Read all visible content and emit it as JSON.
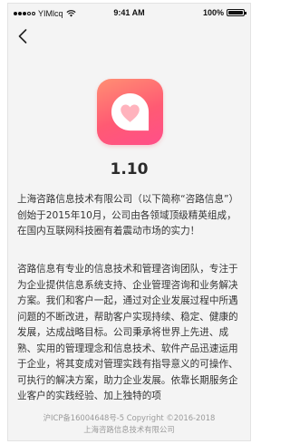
{
  "status_bar": {
    "carrier": "YIMlcq",
    "time": "9:41 AM",
    "battery": "100%",
    "icons": [
      "signal-icon",
      "wifi-icon",
      "battery-icon"
    ]
  },
  "nav": {
    "back_icon": "chevron-left-icon"
  },
  "app": {
    "icon": "heart-chat-app-icon",
    "version": "1.10",
    "colors": {
      "accent_start": "#ff8f73",
      "accent_end": "#ff4f8a"
    }
  },
  "about": {
    "paragraph_1": "上海咨路信息技术有限公司（以下简称“咨路信息”）创始于2015年10月，公司由各领域顶级精英组成，在国内互联网科技圈有着震动市场的实力！",
    "paragraph_2": "咨路信息有专业的信息技术和管理咨询团队，专注于为企业提供信息系统支持、企业管理咨询和业务解决方案。我们和客户一起，通过对企业发展过程中所遇问题的不断改进，帮助客户实现持续、稳定、健康的发展，达成战略目标。公司秉承将世界上先进、成熟、实用的管理理念和信息技术、软件产品迅速运用于企业，将其变成对管理实践有指导意义的可操作、可执行的解决方案，助力企业发展。依靠长期服务企业客户的实践经验、加上独特的项"
  },
  "footer": {
    "line_1": "沪ICP备16004648号-5 Copyright ©2016-2018",
    "line_2": "上海咨路信息技术有限公司"
  }
}
